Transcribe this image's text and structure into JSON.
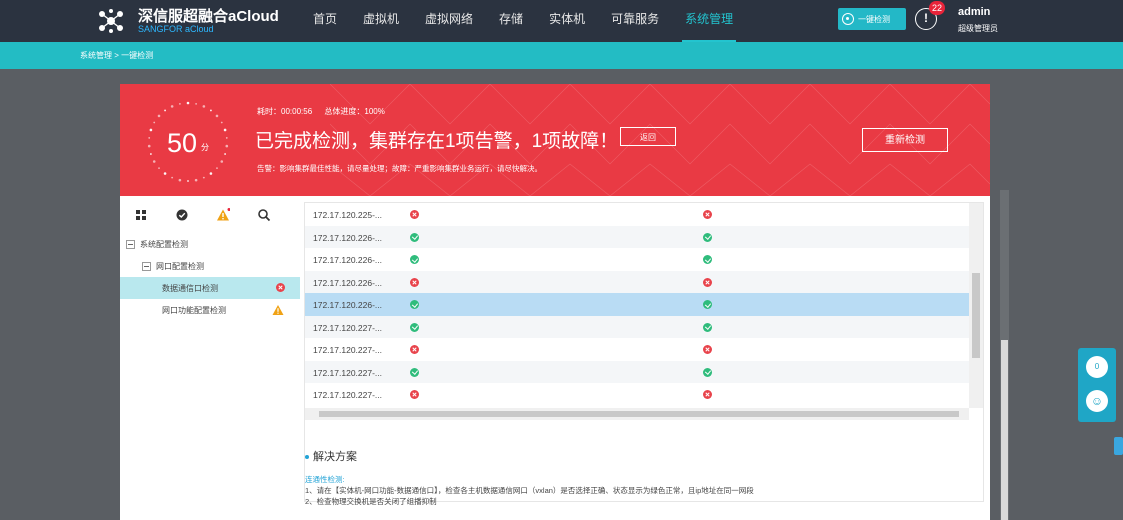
{
  "app": {
    "brand": "深信服超融合aCloud",
    "brand_sub": "SANGFOR aCloud"
  },
  "nav": {
    "items": [
      {
        "label": "首页",
        "active": false
      },
      {
        "label": "虚拟机",
        "active": false
      },
      {
        "label": "虚拟网络",
        "active": false
      },
      {
        "label": "存储",
        "active": false
      },
      {
        "label": "实体机",
        "active": false
      },
      {
        "label": "可靠服务",
        "active": false
      },
      {
        "label": "系统管理",
        "active": true
      }
    ]
  },
  "header_right": {
    "onekey_label": "一键检测",
    "alert_count": "22",
    "user_name": "admin",
    "user_role": "超级管理员"
  },
  "breadcrumb": "系统管理 > 一键检测",
  "result": {
    "score": "50",
    "score_unit": "分",
    "elapsed": "耗时：00:00:56",
    "progress": "总体进度：100%",
    "headline": "已完成检测，集群存在1项告警，1项故障！",
    "back_label": "返回",
    "retest_label": "重新检测",
    "note": "告警：影响集群最佳性能，请尽量处理；故障：严重影响集群业务运行，请尽快解决。"
  },
  "tree": {
    "root": "系统配置检测",
    "group": "网口配置检测",
    "items": [
      {
        "label": "数据通信口检测",
        "status": "error",
        "selected": true
      },
      {
        "label": "网口功能配置检测",
        "status": "warning",
        "selected": false
      }
    ]
  },
  "table": {
    "rows": [
      {
        "ip": "172.17.120.225-...",
        "c1": "error",
        "c2": "error"
      },
      {
        "ip": "172.17.120.226-...",
        "c1": "ok",
        "c2": "ok"
      },
      {
        "ip": "172.17.120.226-...",
        "c1": "ok",
        "c2": "ok"
      },
      {
        "ip": "172.17.120.226-...",
        "c1": "error",
        "c2": "error"
      },
      {
        "ip": "172.17.120.226-...",
        "c1": "ok",
        "c2": "ok",
        "selected": true
      },
      {
        "ip": "172.17.120.227-...",
        "c1": "ok",
        "c2": "ok"
      },
      {
        "ip": "172.17.120.227-...",
        "c1": "error",
        "c2": "error"
      },
      {
        "ip": "172.17.120.227-...",
        "c1": "ok",
        "c2": "ok"
      },
      {
        "ip": "172.17.120.227-...",
        "c1": "error",
        "c2": "error"
      }
    ]
  },
  "solution": {
    "title": "解决方案",
    "subtitle": "连通性检测:",
    "line1": "1、请在【实体机-网口功能-数据通信口】，检查各主机数据通信网口（vxlan）是否选择正确、状态显示为绿色正常，且ip地址在同一网段",
    "line2": "2、检查物理交换机是否关闭了组播抑制"
  },
  "float_panel": {
    "count": "0"
  },
  "colors": {
    "topbar": "#2b3340",
    "accent": "#23bcc4",
    "alert_red": "#e93a44",
    "ok_green": "#2fbc7c"
  }
}
